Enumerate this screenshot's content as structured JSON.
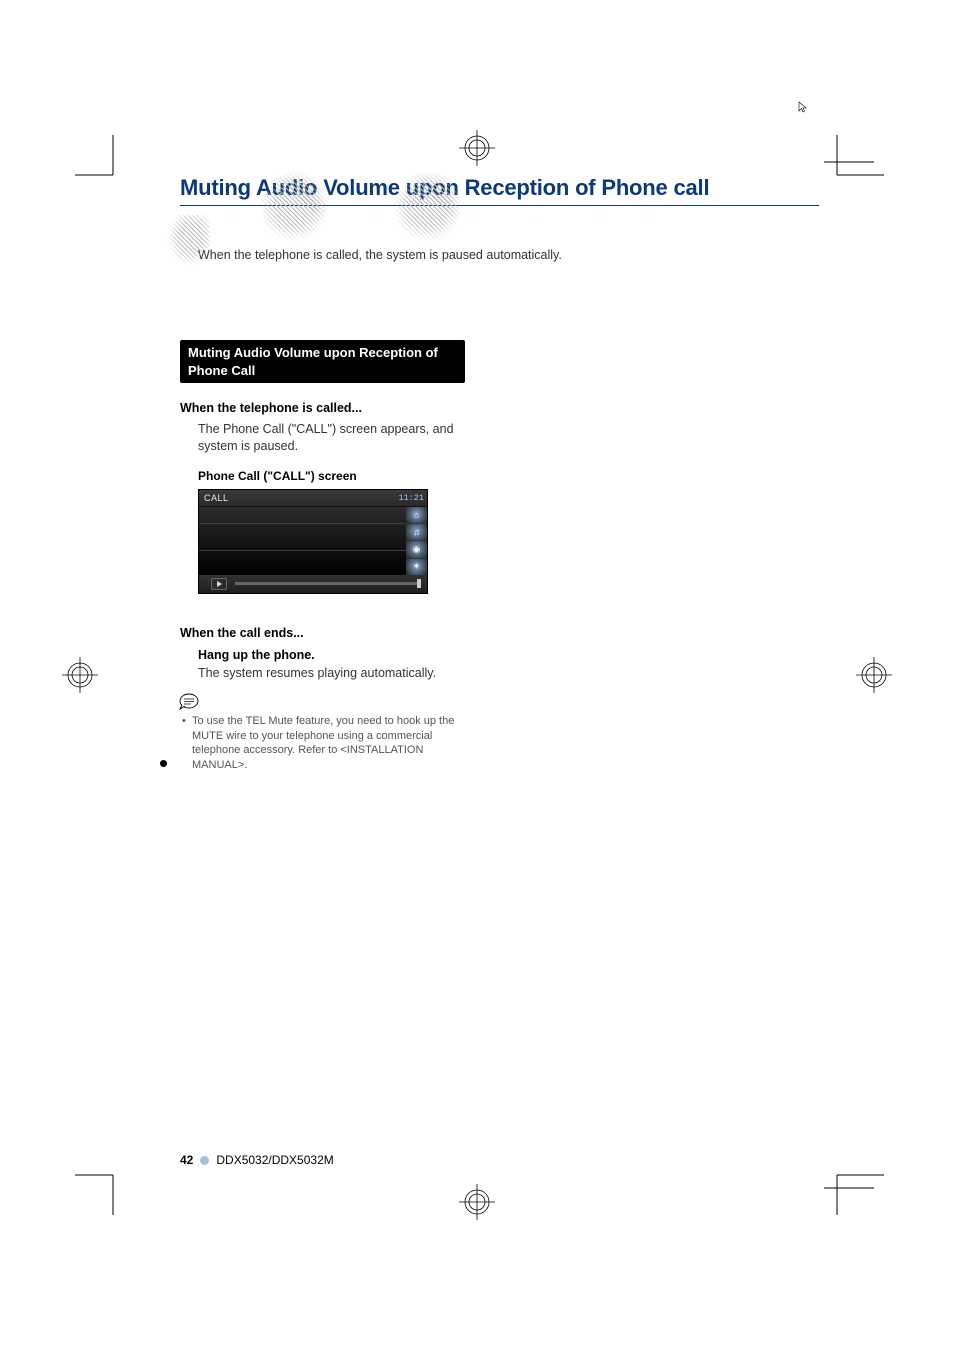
{
  "title": "Muting Audio Volume upon Reception of Phone call",
  "intro": "When the telephone is called, the system is paused automatically.",
  "section_heading": "Muting Audio Volume upon Reception of Phone Call",
  "when_called": {
    "heading": "When the telephone is called...",
    "text": "The Phone Call (\"CALL\") screen appears, and system is paused.",
    "screen_label": "Phone Call (\"CALL\") screen",
    "screen": {
      "call_text": "CALL",
      "time": "11:21"
    }
  },
  "when_ends": {
    "heading": "When the call ends...",
    "instruction": "Hang up the phone.",
    "text": "The system resumes playing automatically."
  },
  "note": {
    "line": "To use the TEL Mute feature, you need to hook up the MUTE wire to your telephone using a commercial telephone accessory. Refer to <INSTALLATION MANUAL>."
  },
  "footer": {
    "page": "42",
    "model": "DDX5032/DDX5032M"
  }
}
